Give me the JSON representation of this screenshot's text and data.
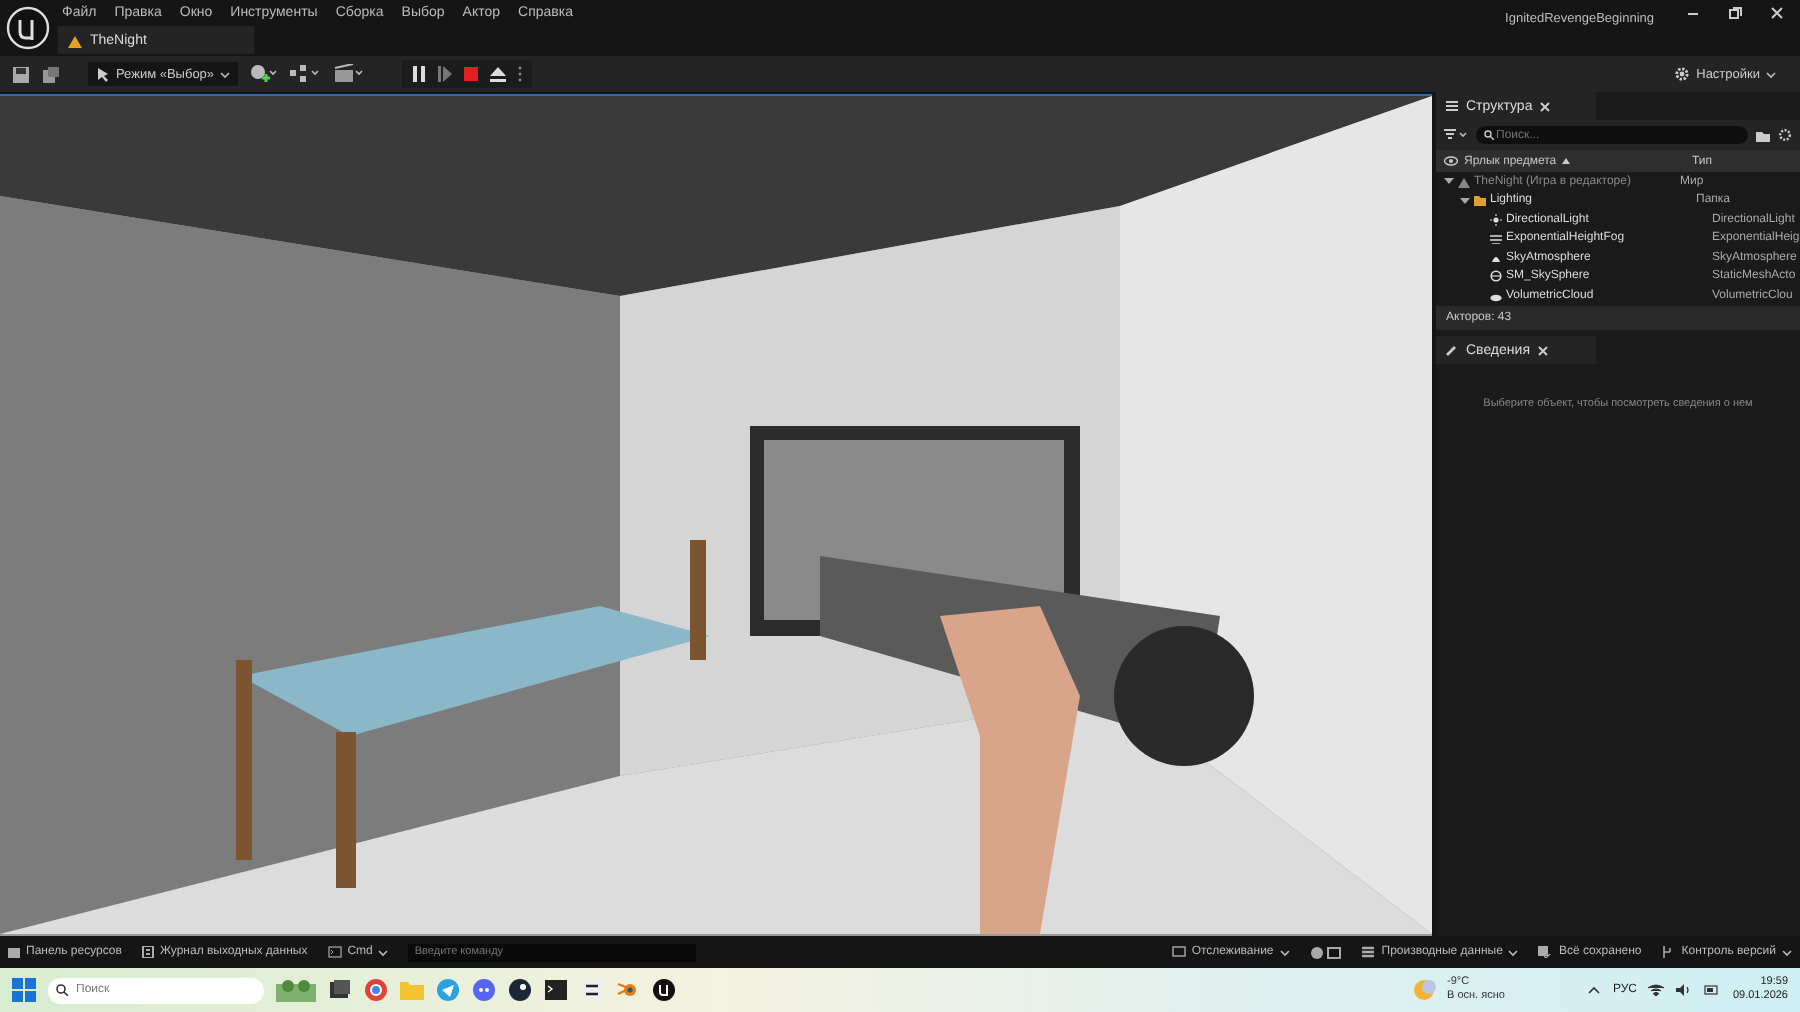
{
  "app": {
    "title": "IgnitedRevengeBeginning"
  },
  "menu": [
    "Файл",
    "Правка",
    "Окно",
    "Инструменты",
    "Сборка",
    "Выбор",
    "Актор",
    "Справка"
  ],
  "document_tab": {
    "label": "TheNight",
    "selected": true
  },
  "toolbar": {
    "mode": "Режим «Выбор»",
    "settings": "Настройки"
  },
  "outliner": {
    "tab": "Структура",
    "search": {
      "placeholder": "Поиск..."
    },
    "columns": [
      "Ярлык предмета",
      "Тип"
    ],
    "tree": [
      {
        "label": "TheNight (Игра в редакторе)",
        "type": "Мир",
        "kind": "world",
        "expanded": true,
        "children": [
          {
            "label": "Lighting",
            "type": "Папка",
            "kind": "folder",
            "expanded": true,
            "children": [
              {
                "label": "DirectionalLight",
                "type": "DirectionalLight",
                "kind": "light"
              },
              {
                "label": "ExponentialHeightFog",
                "type": "ExponentialHeig",
                "kind": "fog"
              },
              {
                "label": "SkyAtmosphere",
                "type": "SkyAtmosphere",
                "kind": "atmosphere"
              },
              {
                "label": "SM_SkySphere",
                "type": "StaticMeshActo",
                "kind": "mesh"
              },
              {
                "label": "VolumetricCloud",
                "type": "VolumetricClou",
                "kind": "cloud"
              }
            ]
          }
        ]
      }
    ],
    "footer": "Акторов: 43"
  },
  "details": {
    "tab": "Сведения",
    "message": "Выберите объект, чтобы посмотреть сведения о нем"
  },
  "status_bar": {
    "left": [
      "Панель ресурсов",
      "Журнал выходных данных"
    ],
    "cmd": "Cmd",
    "command": {
      "placeholder": "Введите команду"
    },
    "right": [
      "Отслеживание",
      "Производные данные",
      "Всё сохранено",
      "Контроль версий"
    ]
  },
  "taskbar": {
    "search": {
      "placeholder": "Поиск"
    },
    "weather": {
      "temp": "-9°C",
      "desc": "В осн. ясно"
    },
    "lang": "РУС",
    "time": "19:59",
    "date": "09.01.2026"
  }
}
